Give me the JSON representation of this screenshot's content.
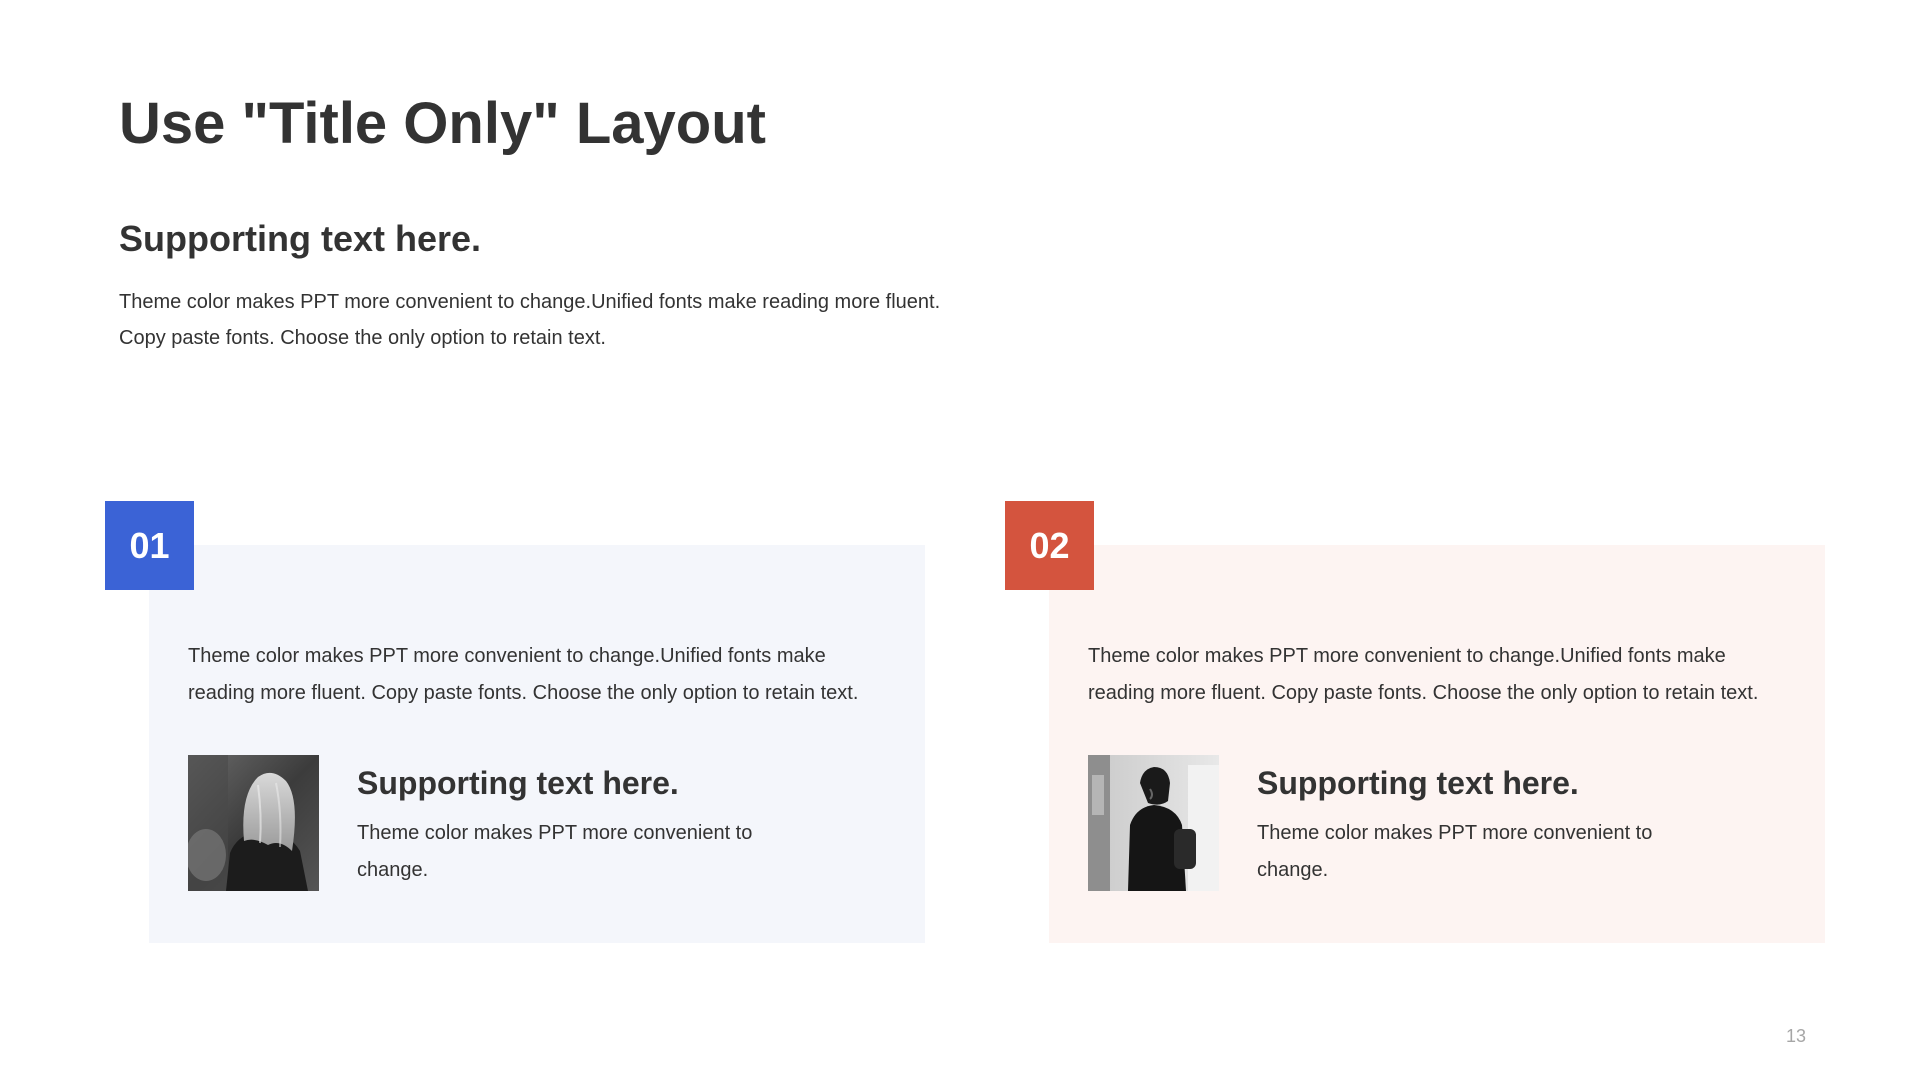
{
  "slide": {
    "title": "Use \"Title Only\" Layout",
    "intro": {
      "heading": "Supporting text here.",
      "body_line1": "Theme  color makes PPT more convenient  to change.Unified  fonts make reading more fluent.",
      "body_line2": "Copy paste  fonts. Choose the only option to retain text."
    },
    "page_number": "13"
  },
  "cards": [
    {
      "number": "01",
      "accent_color": "#3b63d6",
      "background_color": "#f4f6fb",
      "body_line1": "Theme  color makes PPT more convenient  to change.Unified  fonts make",
      "body_line2": "reading more fluent. Copy paste  fonts. Choose the only option to retain text.",
      "sub_heading": "Supporting text here.",
      "sub_body_line1": "Theme  color makes PPT more convenient  to",
      "sub_body_line2": "change.",
      "image": "grayscale-photo-woman-long-hair-from-behind"
    },
    {
      "number": "02",
      "accent_color": "#d4543e",
      "background_color": "#fdf4f2",
      "body_line1": "Theme  color makes PPT more convenient  to change.Unified  fonts make",
      "body_line2": "reading more fluent. Copy paste  fonts. Choose the only option to retain text.",
      "sub_heading": "Supporting text here.",
      "sub_body_line1": "Theme  color makes PPT more convenient  to",
      "sub_body_line2": "change.",
      "image": "grayscale-photo-person-hood-backpack"
    }
  ]
}
